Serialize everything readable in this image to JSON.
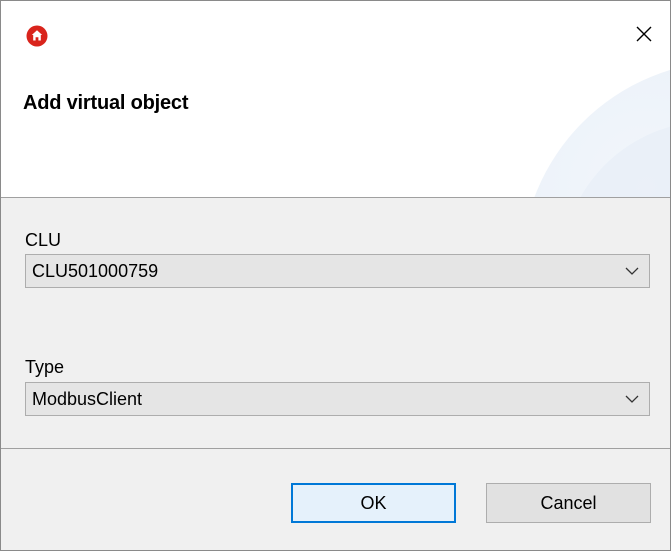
{
  "dialog": {
    "title": "Add virtual object",
    "app_icon": "home-icon",
    "close_icon": "close-icon"
  },
  "form": {
    "clu_label": "CLU",
    "clu_value": "CLU501000759",
    "type_label": "Type",
    "type_value": "ModbusClient"
  },
  "buttons": {
    "ok_label": "OK",
    "cancel_label": "Cancel"
  },
  "colors": {
    "accent": "#0078d7",
    "app_icon": "#d9241c"
  }
}
